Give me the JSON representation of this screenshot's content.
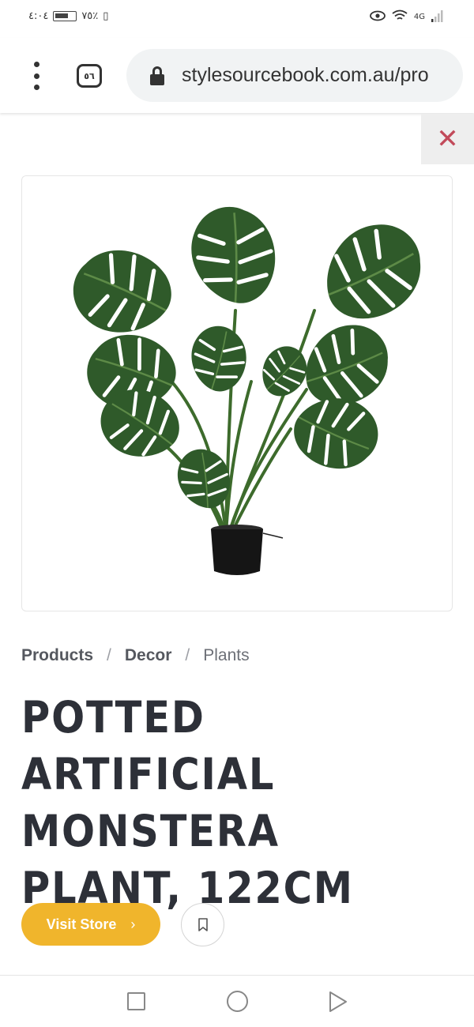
{
  "status_bar": {
    "time": "٤:٠٤",
    "battery": "٧٥٪",
    "network": "4G"
  },
  "browser": {
    "tab_count": "٥٦",
    "url": "stylesourcebook.com.au/pro"
  },
  "close_symbol": "✕",
  "breadcrumb": {
    "items": [
      "Products",
      "Decor",
      "Plants"
    ],
    "separator": "/"
  },
  "product": {
    "title": "POTTED ARTIFICIAL MONSTERA PLANT, 122CM"
  },
  "actions": {
    "visit_store_label": "Visit Store",
    "visit_store_chevron": "›"
  },
  "colors": {
    "accent": "#f0b52c",
    "close": "#c24a5a",
    "title": "#2d3038",
    "leaf": "#2f5a2a"
  }
}
